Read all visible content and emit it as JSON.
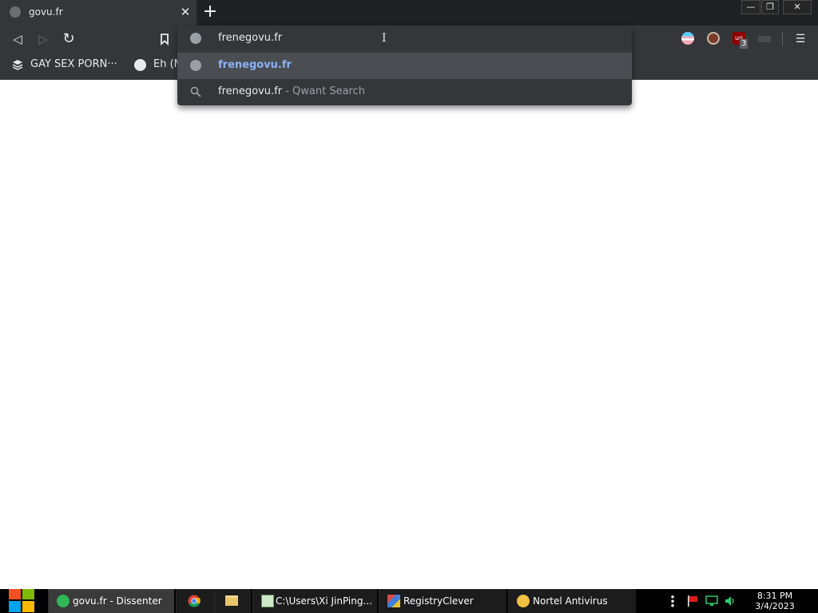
{
  "browser": {
    "tab": {
      "title": "govu.fr",
      "close_glyph": "✕"
    },
    "new_tab_glyph": "+",
    "window_controls": {
      "minimize": "—",
      "restore": "❐",
      "close": "✕"
    },
    "toolbar": {
      "back_glyph": "◁",
      "forward_glyph": "▷",
      "reload_glyph": "↻",
      "address_value": "frenegovu.fr",
      "menu_glyph": "☰",
      "extension_badge": "3",
      "extension_label": "uo"
    },
    "bookmarks": [
      {
        "label": "GAY SEX PORN···",
        "icon": "stack-icon"
      },
      {
        "label": "Eh (M",
        "icon": "globe-icon"
      }
    ]
  },
  "omnibox": {
    "suggestions": [
      {
        "text": "frenegovu.fr",
        "suffix": "",
        "icon": "globe-icon",
        "selected": true
      },
      {
        "text": "frenegovu.fr",
        "suffix": " - Qwant Search",
        "icon": "search-icon",
        "selected": false
      }
    ]
  },
  "taskbar": {
    "tasks": [
      {
        "label": "govu.fr - Dissenter",
        "icon": "dissenter-icon"
      },
      {
        "label": "",
        "icon": "chrome-icon"
      },
      {
        "label": "",
        "icon": "folder-icon"
      },
      {
        "label": "C:\\Users\\Xi JinPing...",
        "icon": "notepad-icon"
      },
      {
        "label": "RegistryClever",
        "icon": "registry-cube-icon"
      },
      {
        "label": "Nortel  Antivirus",
        "icon": "antivirus-shield-icon"
      }
    ],
    "clock": {
      "time": "8:31 PM",
      "date": "3/4/2023"
    }
  },
  "colors": {
    "chrome_dark": "#202124",
    "toolbar": "#35363a",
    "selected_link": "#8ab4f8",
    "taskbar": "#000000"
  }
}
